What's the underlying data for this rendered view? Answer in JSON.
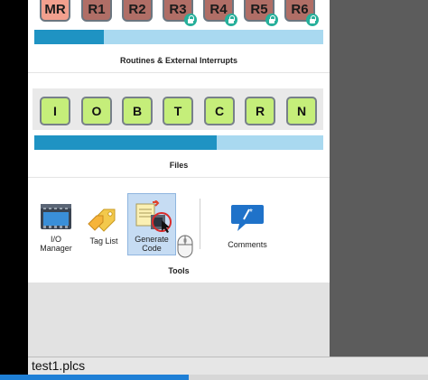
{
  "registers": [
    {
      "label": "MR",
      "locked": false
    },
    {
      "label": "R1",
      "locked": false
    },
    {
      "label": "R2",
      "locked": false
    },
    {
      "label": "R3",
      "locked": true
    },
    {
      "label": "R4",
      "locked": true
    },
    {
      "label": "R5",
      "locked": true
    },
    {
      "label": "R6",
      "locked": true
    }
  ],
  "registers_bar_progress": 0.24,
  "sections": {
    "routines": "Routines & External Interrupts",
    "files": "Files",
    "tools": "Tools"
  },
  "file_buttons": [
    "I",
    "O",
    "B",
    "T",
    "C",
    "R",
    "N"
  ],
  "files_bar_progress": 0.63,
  "tools": {
    "io_manager": "I/O\nManager",
    "tag_list": "Tag List",
    "generate_code": "Generate\nCode",
    "comments": "Comments"
  },
  "icons": {
    "io_manager": "io-manager-icon",
    "tag_list": "tag-list-icon",
    "generate_code": "generate-code-icon",
    "comments": "comments-icon",
    "mouse": "mouse-icon",
    "lock": "lock-icon"
  },
  "status": {
    "filename": "test1.plcs",
    "progress": 0.44
  },
  "colors": {
    "bar_fill": "#1f93c3",
    "bar_track": "#a9d9f0",
    "file_button": "#c5ee7a",
    "register": "#b06e66",
    "register_mr": "#f2a08e",
    "selection": "#c6dcf3"
  }
}
